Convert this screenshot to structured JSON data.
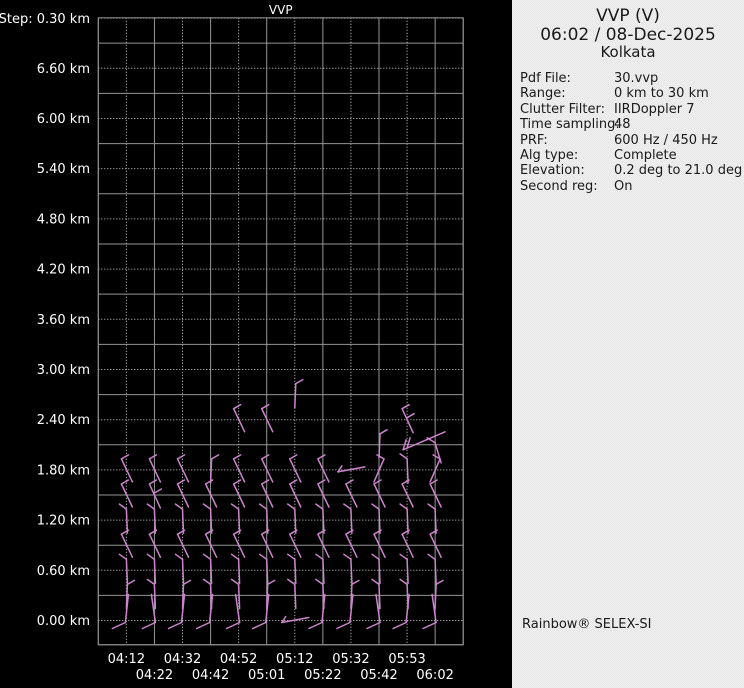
{
  "panel": {
    "title": "VVP (V)",
    "datetime": "06:02 / 08-Dec-2025",
    "site": "Kolkata",
    "rows": [
      {
        "label": "Pdf File:",
        "value": "30.vvp"
      },
      {
        "label": "Range:",
        "value": "0 km to 30 km"
      },
      {
        "label": "Clutter Filter:",
        "value": "IIRDoppler 7"
      },
      {
        "label": "Time sampling:",
        "value": "48"
      },
      {
        "label": "PRF:",
        "value": "600 Hz / 450 Hz"
      },
      {
        "label": "Alg type:",
        "value": "Complete"
      },
      {
        "label": "Elevation:",
        "value": "0.2 deg to 21.0 deg"
      },
      {
        "label": "Second reg:",
        "value": "On"
      }
    ],
    "footer": "Rainbow® SELEX-SI"
  },
  "colors": {
    "background": "#000000",
    "grid_solid": "#969696",
    "grid_dotted": "#d2d2d2",
    "axis_text": "#ffffff",
    "barb": "#cd84cd",
    "panel_bg": "#ececec",
    "panel_text": "#1a1a1a"
  },
  "chart_data": {
    "type": "wind_barb_time_height_profile",
    "title": "VVP",
    "step_label": "Step: 0.30 km",
    "y_unit": " km",
    "y_tick_labels": [
      "6.60",
      "6.00",
      "5.40",
      "4.80",
      "4.20",
      "3.60",
      "3.00",
      "2.40",
      "1.80",
      "1.20",
      "0.60",
      "0.00"
    ],
    "y_tick_heights_km": [
      6.6,
      6.0,
      5.4,
      4.8,
      4.2,
      3.6,
      3.0,
      2.4,
      1.8,
      1.2,
      0.6,
      0.0
    ],
    "y_range_km": [
      0.0,
      7.2
    ],
    "y_step_km": 0.3,
    "x_tick_labels": [
      "04:12",
      "04:22",
      "04:32",
      "04:42",
      "04:52",
      "05:01",
      "05:12",
      "05:22",
      "05:32",
      "05:42",
      "05:53",
      "06:02"
    ],
    "grid": "solid lines alternate with dotted lines every half step; labels sit on dotted lines",
    "legend": "wind barbs (direction staffs with feathers) per time/height cell",
    "shapes": {
      "k1": [
        [
          6,
          12,
          -5,
          -11
        ],
        [
          -5,
          -11,
          2,
          -15
        ]
      ],
      "k2": [
        [
          6,
          13,
          -5,
          -11
        ],
        [
          -5,
          -11,
          2,
          -15
        ],
        [
          0,
          -2,
          7,
          -6
        ]
      ],
      "k1m": [
        [
          -5,
          12,
          5,
          -11
        ],
        [
          5,
          -11,
          -2,
          -15
        ]
      ],
      "vl": [
        [
          1,
          13,
          0,
          -11
        ],
        [
          0,
          -11,
          -7,
          -16
        ]
      ],
      "vr": [
        [
          0,
          13,
          1,
          -11
        ],
        [
          1,
          -11,
          8,
          -15
        ]
      ],
      "hook": [
        [
          2,
          -26,
          -1,
          2
        ],
        [
          -1,
          2,
          -14,
          8
        ]
      ],
      "hookr": [
        [
          -3,
          -26,
          1,
          2
        ],
        [
          1,
          2,
          -12,
          8
        ]
      ],
      "horiz_r": [
        [
          -13,
          2,
          14,
          -3
        ],
        [
          -13,
          2,
          -9,
          -4
        ]
      ],
      "diag_e": [
        [
          -4,
          5,
          38,
          -13
        ],
        [
          -4,
          5,
          -1,
          -5
        ],
        [
          0,
          3,
          3,
          -7
        ]
      ],
      "hang_r": [
        [
          0,
          -2,
          6,
          18
        ],
        [
          0,
          -2,
          -8,
          -7
        ]
      ]
    },
    "barbs": [
      [
        1,
        1.8,
        "k1"
      ],
      [
        1,
        1.5,
        "k1"
      ],
      [
        1,
        1.2,
        "vl"
      ],
      [
        1,
        0.9,
        "k1"
      ],
      [
        1,
        0.6,
        "vl"
      ],
      [
        1,
        0.3,
        "vr"
      ],
      [
        1,
        0.0,
        "hook"
      ],
      [
        2,
        1.8,
        "k1"
      ],
      [
        2,
        1.5,
        "k2"
      ],
      [
        2,
        1.2,
        "vl"
      ],
      [
        2,
        0.9,
        "k1"
      ],
      [
        2,
        0.6,
        "vl"
      ],
      [
        2,
        0.3,
        "vl"
      ],
      [
        2,
        0.0,
        "hookr"
      ],
      [
        3,
        1.8,
        "k1"
      ],
      [
        3,
        1.5,
        "k1"
      ],
      [
        3,
        1.2,
        "vl"
      ],
      [
        3,
        0.9,
        "k1"
      ],
      [
        3,
        0.6,
        "vl"
      ],
      [
        3,
        0.3,
        "vr"
      ],
      [
        3,
        0.0,
        "hook"
      ],
      [
        4,
        1.8,
        "vr"
      ],
      [
        4,
        1.5,
        "k1"
      ],
      [
        4,
        1.2,
        "vl"
      ],
      [
        4,
        0.9,
        "k1"
      ],
      [
        4,
        0.6,
        "vl"
      ],
      [
        4,
        0.3,
        "vl"
      ],
      [
        4,
        0.0,
        "hook"
      ],
      [
        5,
        2.4,
        "k1"
      ],
      [
        5,
        1.8,
        "k1"
      ],
      [
        5,
        1.5,
        "k1"
      ],
      [
        5,
        1.2,
        "vl"
      ],
      [
        5,
        0.9,
        "k1"
      ],
      [
        5,
        0.6,
        "vl"
      ],
      [
        5,
        0.3,
        "vl"
      ],
      [
        5,
        0.0,
        "hookr"
      ],
      [
        6,
        2.4,
        "k1"
      ],
      [
        6,
        1.8,
        "k1"
      ],
      [
        6,
        1.5,
        "k1"
      ],
      [
        6,
        1.2,
        "vl"
      ],
      [
        6,
        0.9,
        "k1"
      ],
      [
        6,
        0.6,
        "vl"
      ],
      [
        6,
        0.3,
        "vr"
      ],
      [
        6,
        0.0,
        "hook"
      ],
      [
        7,
        2.7,
        "vr"
      ],
      [
        7,
        1.8,
        "k1"
      ],
      [
        7,
        1.5,
        "k1"
      ],
      [
        7,
        1.2,
        "vl"
      ],
      [
        7,
        0.9,
        "k1"
      ],
      [
        7,
        0.6,
        "vl"
      ],
      [
        7,
        0.3,
        "vl"
      ],
      [
        7,
        0.0,
        "horiz_r"
      ],
      [
        8,
        1.8,
        "k1"
      ],
      [
        8,
        1.5,
        "k1"
      ],
      [
        8,
        1.2,
        "vl"
      ],
      [
        8,
        0.9,
        "k1"
      ],
      [
        8,
        0.6,
        "vl"
      ],
      [
        8,
        0.3,
        "vl"
      ],
      [
        8,
        0.0,
        "hook"
      ],
      [
        9,
        1.8,
        "horiz_r"
      ],
      [
        9,
        1.5,
        "k1"
      ],
      [
        9,
        1.2,
        "vl"
      ],
      [
        9,
        0.9,
        "k1"
      ],
      [
        9,
        0.6,
        "vl"
      ],
      [
        9,
        0.3,
        "vr"
      ],
      [
        9,
        0.0,
        "hook"
      ],
      [
        10,
        2.1,
        "vr"
      ],
      [
        10,
        1.8,
        "k1m"
      ],
      [
        10,
        1.5,
        "k1"
      ],
      [
        10,
        1.2,
        "vl"
      ],
      [
        10,
        0.9,
        "k1"
      ],
      [
        10,
        0.6,
        "vl"
      ],
      [
        10,
        0.3,
        "vl"
      ],
      [
        10,
        0.0,
        "hookr"
      ],
      [
        11,
        2.4,
        "k2"
      ],
      [
        11,
        2.1,
        "diag_e"
      ],
      [
        11,
        1.8,
        "vl"
      ],
      [
        11,
        1.5,
        "k1"
      ],
      [
        11,
        1.2,
        "vl"
      ],
      [
        11,
        0.9,
        "k1"
      ],
      [
        11,
        0.6,
        "vl"
      ],
      [
        11,
        0.3,
        "vl"
      ],
      [
        11,
        0.0,
        "hook"
      ],
      [
        12,
        2.1,
        "hang_r"
      ],
      [
        12,
        1.8,
        "k1m"
      ],
      [
        12,
        1.5,
        "k1"
      ],
      [
        12,
        1.2,
        "vl"
      ],
      [
        12,
        0.9,
        "k1"
      ],
      [
        12,
        0.6,
        "vl"
      ],
      [
        12,
        0.3,
        "vr"
      ],
      [
        12,
        0.0,
        "hookr"
      ]
    ]
  }
}
